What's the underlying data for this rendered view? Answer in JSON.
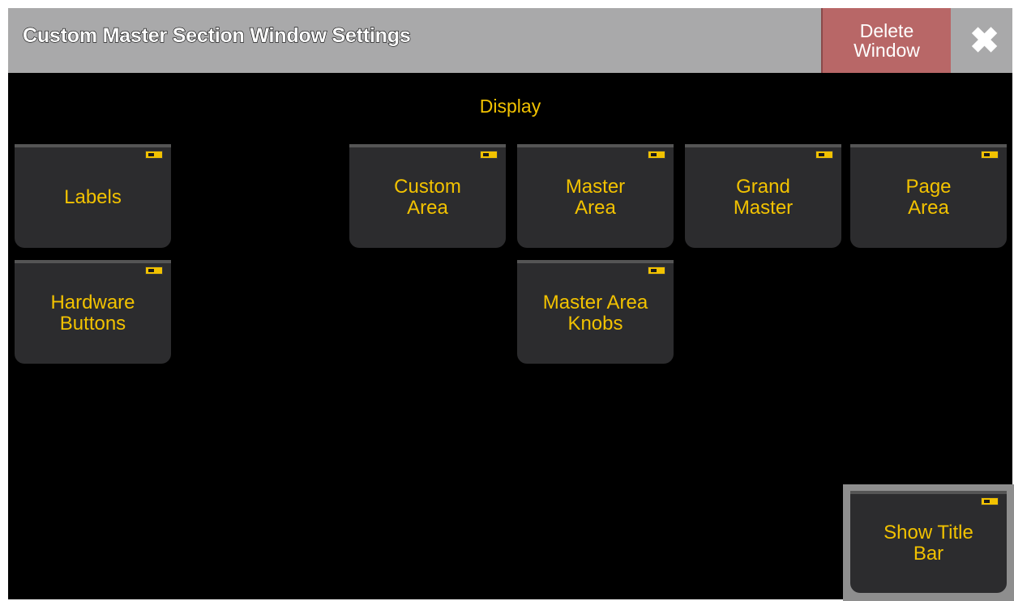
{
  "window": {
    "title": "Custom Master Section Window Settings",
    "delete_label": "Delete\nWindow",
    "close_icon": "close-icon"
  },
  "section": {
    "label": "Display"
  },
  "tiles": {
    "labels": "Labels",
    "hardware_buttons": "Hardware\nButtons",
    "custom_area": "Custom\nArea",
    "master_area": "Master\nArea",
    "grand_master": "Grand\nMaster",
    "page_area": "Page\nArea",
    "master_area_knobs": "Master Area\nKnobs",
    "show_title_bar": "Show Title\nBar"
  },
  "colors": {
    "accent": "#f2c200",
    "titlebar": "#a9a9aa",
    "delete": "#b86767",
    "tile": "#2c2c2e"
  }
}
